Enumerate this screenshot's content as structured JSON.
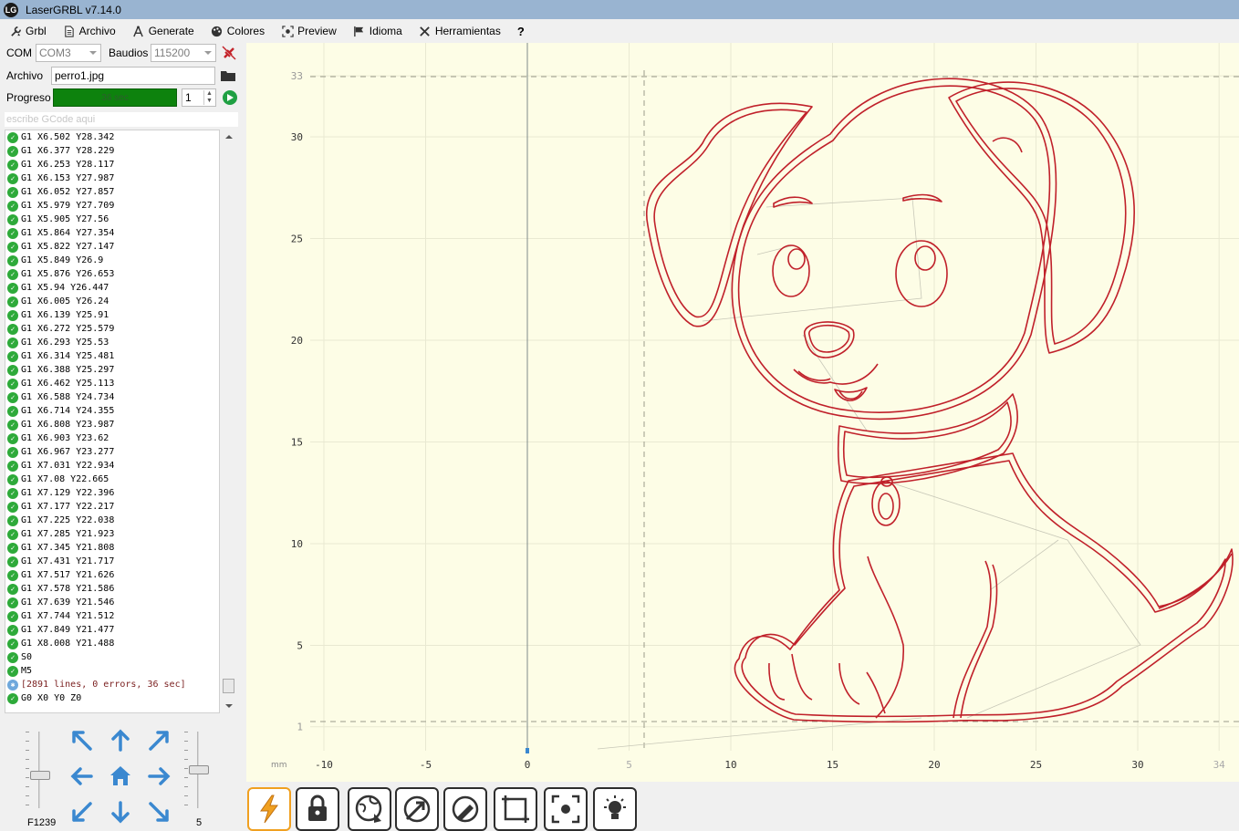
{
  "window": {
    "title": "LaserGRBL v7.14.0",
    "icon_label": "LG"
  },
  "menu": [
    {
      "label": "Grbl",
      "icon": "wrench-icon"
    },
    {
      "label": "Archivo",
      "icon": "document-icon"
    },
    {
      "label": "Generate",
      "icon": "compass-icon"
    },
    {
      "label": "Colores",
      "icon": "palette-icon"
    },
    {
      "label": "Preview",
      "icon": "preview-icon"
    },
    {
      "label": "Idioma",
      "icon": "flag-icon"
    },
    {
      "label": "Herramientas",
      "icon": "tools-icon"
    },
    {
      "label": "?",
      "icon": ""
    }
  ],
  "connection": {
    "com_label": "COM",
    "com_value": "COM3",
    "baud_label": "Baudios",
    "baud_value": "115200"
  },
  "file": {
    "label": "Archivo",
    "value": "perro1.jpg"
  },
  "progress": {
    "label": "Progreso",
    "text": "36 sec",
    "fraction": 1.0,
    "passes": "1"
  },
  "gcode_input": {
    "placeholder": "escribe GCode aqui"
  },
  "log": [
    {
      "text": "G1 X6.502 Y28.342",
      "status": "ok"
    },
    {
      "text": "G1 X6.377 Y28.229",
      "status": "ok"
    },
    {
      "text": "G1 X6.253 Y28.117",
      "status": "ok"
    },
    {
      "text": "G1 X6.153 Y27.987",
      "status": "ok"
    },
    {
      "text": "G1 X6.052 Y27.857",
      "status": "ok"
    },
    {
      "text": "G1 X5.979 Y27.709",
      "status": "ok"
    },
    {
      "text": "G1 X5.905 Y27.56",
      "status": "ok"
    },
    {
      "text": "G1 X5.864 Y27.354",
      "status": "ok"
    },
    {
      "text": "G1 X5.822 Y27.147",
      "status": "ok"
    },
    {
      "text": "G1 X5.849 Y26.9",
      "status": "ok"
    },
    {
      "text": "G1 X5.876 Y26.653",
      "status": "ok"
    },
    {
      "text": "G1 X5.94 Y26.447",
      "status": "ok"
    },
    {
      "text": "G1 X6.005 Y26.24",
      "status": "ok"
    },
    {
      "text": "G1 X6.139 Y25.91",
      "status": "ok"
    },
    {
      "text": "G1 X6.272 Y25.579",
      "status": "ok"
    },
    {
      "text": "G1 X6.293 Y25.53",
      "status": "ok"
    },
    {
      "text": "G1 X6.314 Y25.481",
      "status": "ok"
    },
    {
      "text": "G1 X6.388 Y25.297",
      "status": "ok"
    },
    {
      "text": "G1 X6.462 Y25.113",
      "status": "ok"
    },
    {
      "text": "G1 X6.588 Y24.734",
      "status": "ok"
    },
    {
      "text": "G1 X6.714 Y24.355",
      "status": "ok"
    },
    {
      "text": "G1 X6.808 Y23.987",
      "status": "ok"
    },
    {
      "text": "G1 X6.903 Y23.62",
      "status": "ok"
    },
    {
      "text": "G1 X6.967 Y23.277",
      "status": "ok"
    },
    {
      "text": "G1 X7.031 Y22.934",
      "status": "ok"
    },
    {
      "text": "G1 X7.08 Y22.665",
      "status": "ok"
    },
    {
      "text": "G1 X7.129 Y22.396",
      "status": "ok"
    },
    {
      "text": "G1 X7.177 Y22.217",
      "status": "ok"
    },
    {
      "text": "G1 X7.225 Y22.038",
      "status": "ok"
    },
    {
      "text": "G1 X7.285 Y21.923",
      "status": "ok"
    },
    {
      "text": "G1 X7.345 Y21.808",
      "status": "ok"
    },
    {
      "text": "G1 X7.431 Y21.717",
      "status": "ok"
    },
    {
      "text": "G1 X7.517 Y21.626",
      "status": "ok"
    },
    {
      "text": "G1 X7.578 Y21.586",
      "status": "ok"
    },
    {
      "text": "G1 X7.639 Y21.546",
      "status": "ok"
    },
    {
      "text": "G1 X7.744 Y21.512",
      "status": "ok"
    },
    {
      "text": "G1 X7.849 Y21.477",
      "status": "ok"
    },
    {
      "text": "G1 X8.008 Y21.488",
      "status": "ok"
    },
    {
      "text": "S0",
      "status": "ok"
    },
    {
      "text": "M5",
      "status": "ok"
    },
    {
      "text": "[2891 lines, 0 errors, 36 sec]",
      "status": "info"
    },
    {
      "text": "G0 X0 Y0 Z0",
      "status": "ok"
    }
  ],
  "jog": {
    "feed_label": "F1239",
    "step_label": "5"
  },
  "canvas": {
    "unit_label": "mm",
    "x_ticks": [
      "-10",
      "-5",
      "0",
      "5",
      "10",
      "15",
      "20",
      "25",
      "30",
      "34"
    ],
    "y_ticks": [
      "33",
      "30",
      "25",
      "20",
      "15",
      "10",
      "5",
      "1"
    ],
    "background": "#fdfde6",
    "drawing_color": "#c0202a"
  },
  "toolbar": [
    {
      "name": "laser-icon",
      "active": true
    },
    {
      "name": "unlock-icon",
      "active": false
    },
    {
      "name": "globe-home-icon",
      "active": false
    },
    {
      "name": "set-origin-icon",
      "active": false
    },
    {
      "name": "reset-origin-icon",
      "active": false
    },
    {
      "name": "frame-icon",
      "active": false
    },
    {
      "name": "center-icon",
      "active": false
    },
    {
      "name": "bulb-icon",
      "active": false
    }
  ]
}
